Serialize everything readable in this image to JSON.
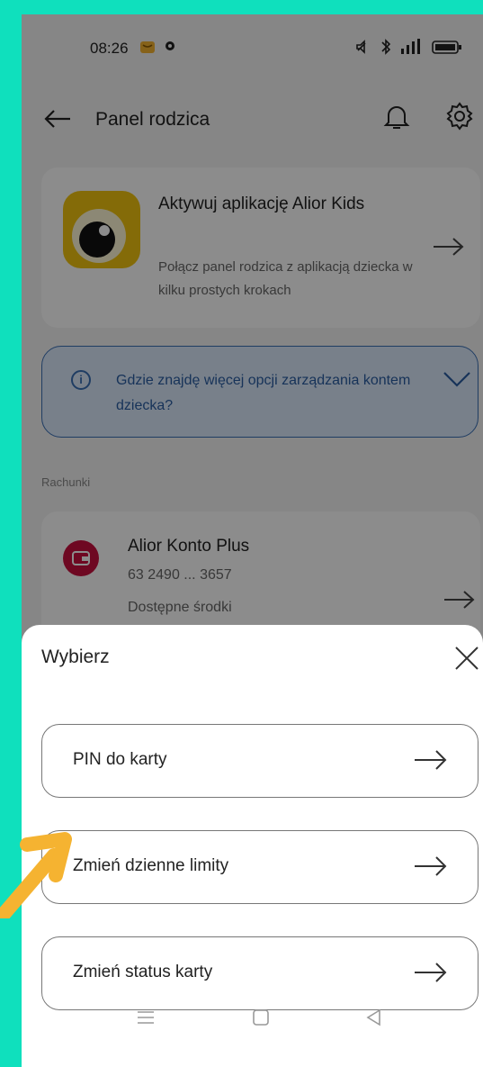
{
  "status": {
    "time": "08:26"
  },
  "header": {
    "back": "←",
    "title": "Panel rodzica"
  },
  "promo": {
    "title": "Aktywuj aplikację Alior Kids",
    "subtitle": "Połącz panel rodzica z aplikacją dziecka w kilku prostych krokach"
  },
  "info": {
    "text": "Gdzie znajdę więcej opcji zarządzania kontem dziecka?"
  },
  "section": {
    "accounts": "Rachunki"
  },
  "account": {
    "name": "Alior Konto Plus",
    "number": "63 2490 ... 3657",
    "available": "Dostępne środki"
  },
  "sheet": {
    "title": "Wybierz",
    "options": [
      {
        "label": "PIN do karty"
      },
      {
        "label": "Zmień dzienne limity"
      },
      {
        "label": "Zmień status karty"
      }
    ]
  },
  "colors": {
    "background": "#0FE0BD",
    "accent_arrow": "#F5B331",
    "account_icon": "#C8103E",
    "info_blue": "#3A6FB5"
  }
}
